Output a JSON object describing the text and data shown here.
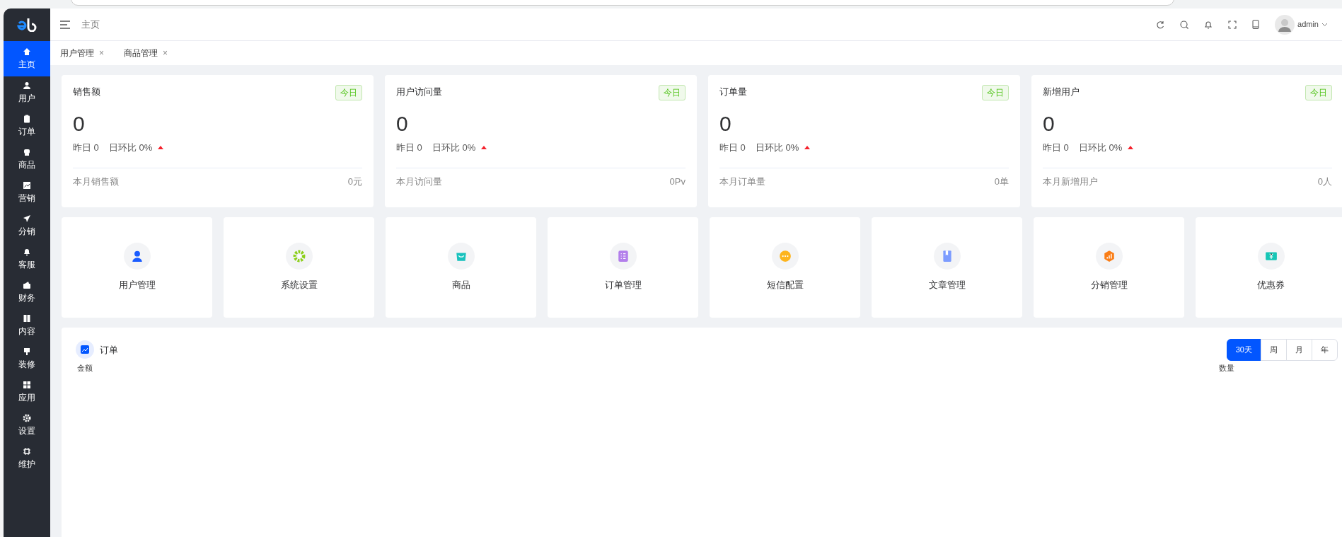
{
  "sidebar": {
    "items": [
      {
        "label": "主页",
        "selected": true
      },
      {
        "label": "用户",
        "selected": false
      },
      {
        "label": "订单",
        "selected": false
      },
      {
        "label": "商品",
        "selected": false
      },
      {
        "label": "营销",
        "selected": false
      },
      {
        "label": "分销",
        "selected": false
      },
      {
        "label": "客服",
        "selected": false
      },
      {
        "label": "财务",
        "selected": false
      },
      {
        "label": "内容",
        "selected": false
      },
      {
        "label": "装修",
        "selected": false
      },
      {
        "label": "应用",
        "selected": false
      },
      {
        "label": "设置",
        "selected": false
      },
      {
        "label": "维护",
        "selected": false
      }
    ]
  },
  "header": {
    "breadcrumb": "主页",
    "user": "admin"
  },
  "tabs": [
    {
      "label": "用户管理",
      "close": "×"
    },
    {
      "label": "商品管理",
      "close": "×"
    }
  ],
  "stats": [
    {
      "title": "销售额",
      "badge": "今日",
      "value": "0",
      "yesterday": "昨日 0",
      "ratio": "日环比 0%",
      "footer_label": "本月销售额",
      "footer_value": "0元"
    },
    {
      "title": "用户访问量",
      "badge": "今日",
      "value": "0",
      "yesterday": "昨日 0",
      "ratio": "日环比 0%",
      "footer_label": "本月访问量",
      "footer_value": "0Pv"
    },
    {
      "title": "订单量",
      "badge": "今日",
      "value": "0",
      "yesterday": "昨日 0",
      "ratio": "日环比 0%",
      "footer_label": "本月订单量",
      "footer_value": "0单"
    },
    {
      "title": "新增用户",
      "badge": "今日",
      "value": "0",
      "yesterday": "昨日 0",
      "ratio": "日环比 0%",
      "footer_label": "本月新增用户",
      "footer_value": "0人"
    }
  ],
  "shortcuts": [
    {
      "label": "用户管理",
      "color": "#1a5cff"
    },
    {
      "label": "系统设置",
      "color": "#8ccf1a"
    },
    {
      "label": "商品",
      "color": "#19c2bd"
    },
    {
      "label": "订单管理",
      "color": "#b37feb"
    },
    {
      "label": "短信配置",
      "color": "#fdb41d"
    },
    {
      "label": "文章管理",
      "color": "#7c9cff"
    },
    {
      "label": "分销管理",
      "color": "#fa7d16"
    },
    {
      "label": "优惠券",
      "color": "#17c6b6"
    }
  ],
  "order_chart": {
    "title": "订单",
    "periods": [
      {
        "label": "30天",
        "selected": true
      },
      {
        "label": "周",
        "selected": false
      },
      {
        "label": "月",
        "selected": false
      },
      {
        "label": "年",
        "selected": false
      }
    ],
    "left_axis": "金额",
    "right_axis": "数量"
  }
}
